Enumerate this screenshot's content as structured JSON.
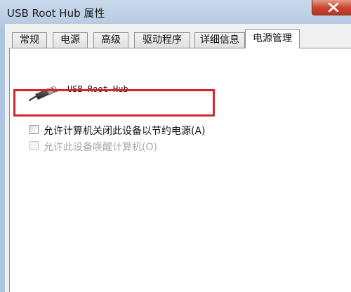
{
  "window": {
    "title": "USB Root Hub 属性"
  },
  "tabs": [
    {
      "label": "常规",
      "active": false
    },
    {
      "label": "电源",
      "active": false
    },
    {
      "label": "高级",
      "active": false
    },
    {
      "label": "驱动程序",
      "active": false
    },
    {
      "label": "详细信息",
      "active": false
    },
    {
      "label": "电源管理",
      "active": true
    }
  ],
  "device": {
    "name": "USB Root Hub",
    "icon": "usb-connector-icon"
  },
  "options": [
    {
      "label": "允许计算机关闭此设备以节约电源(A)",
      "checked": false,
      "enabled": true
    },
    {
      "label": "允许此设备唤醒计算机(O)",
      "checked": false,
      "enabled": false
    }
  ],
  "colors": {
    "highlight": "#d3272e",
    "close_button": "#c7442e",
    "title_bar": "#b9cde3"
  }
}
